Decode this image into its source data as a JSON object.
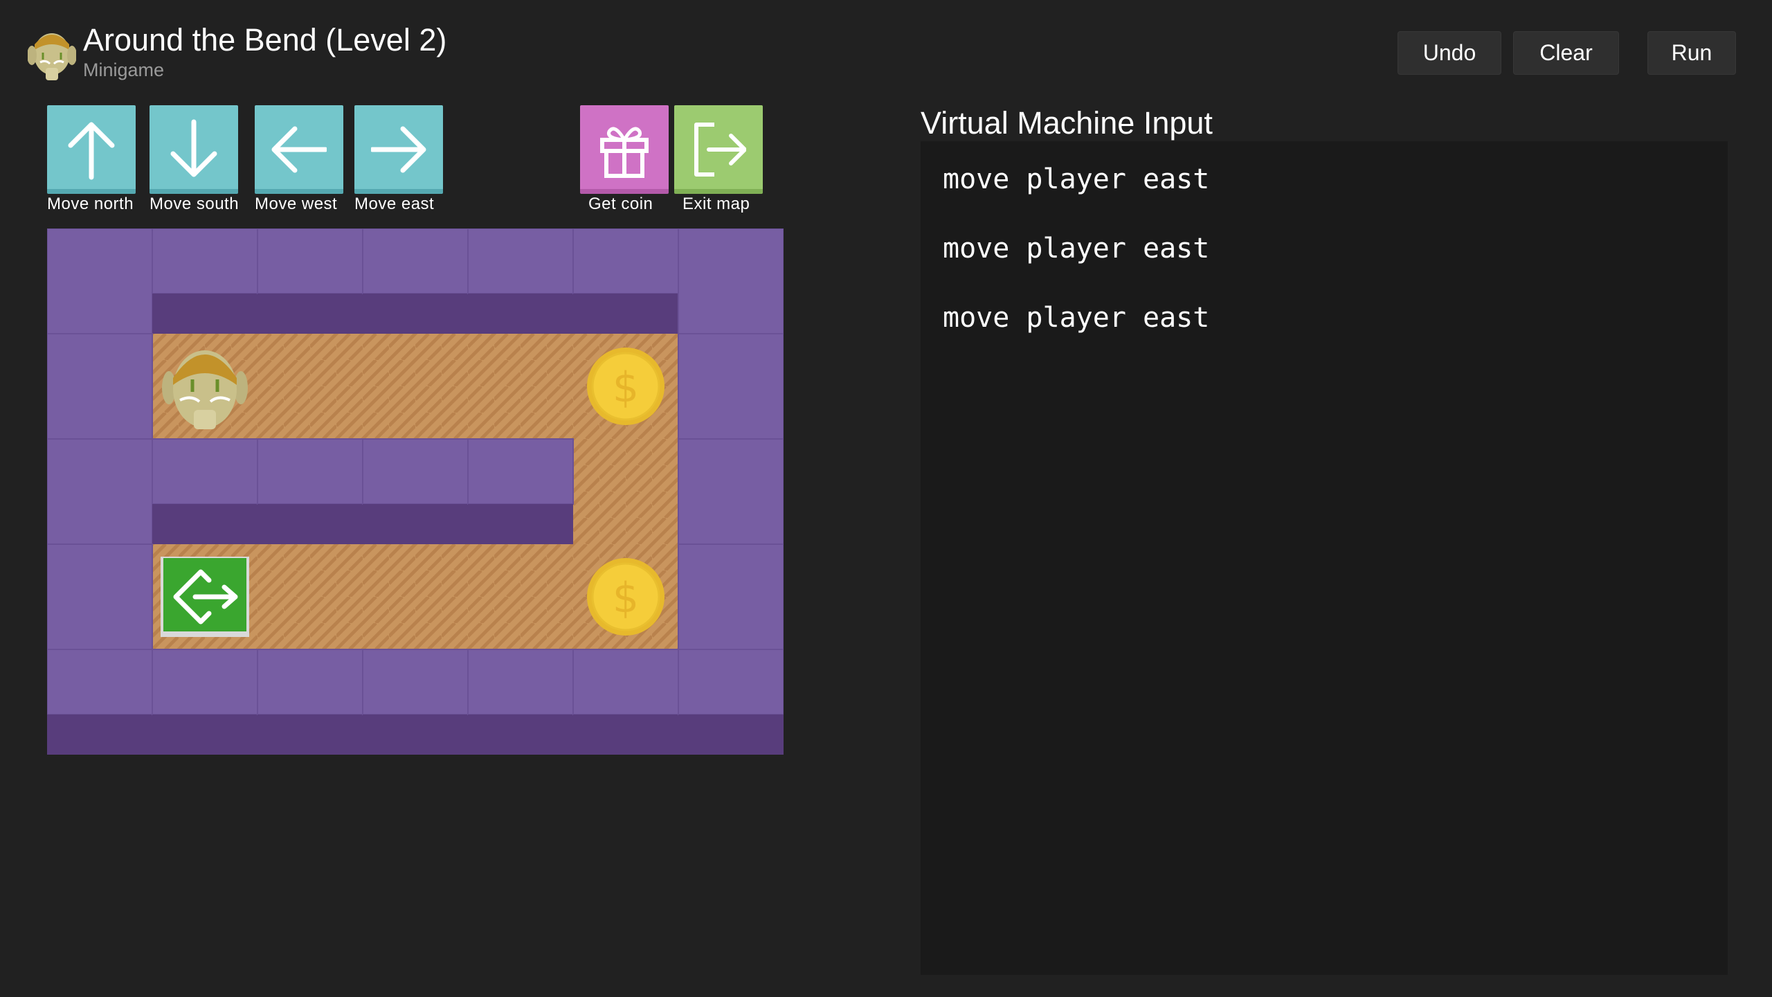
{
  "header": {
    "title": "Around the Bend (Level 2)",
    "subtitle": "Minigame",
    "icon": "goblin-avatar-icon",
    "buttons": {
      "undo": "Undo",
      "clear": "Clear",
      "run": "Run"
    }
  },
  "commands": [
    {
      "label": "Move north",
      "icon": "arrow-up-icon",
      "color": "#74c6cb"
    },
    {
      "label": "Move south",
      "icon": "arrow-down-icon",
      "color": "#74c6cb"
    },
    {
      "label": "Move west",
      "icon": "arrow-left-icon",
      "color": "#74c6cb"
    },
    {
      "label": "Move east",
      "icon": "arrow-right-icon",
      "color": "#74c6cb"
    },
    {
      "label": "Get coin",
      "icon": "gift-icon",
      "color": "#cf72c5"
    },
    {
      "label": "Exit map",
      "icon": "exit-icon",
      "color": "#9ccb70"
    }
  ],
  "board": {
    "cols": 7,
    "rows": 5,
    "grid": [
      "WWWWWWW",
      "WPFFFCW",
      "WWWWWFW",
      "WEFFFCW",
      "WWWWWWW"
    ],
    "legend": {
      "W": "wall",
      "F": "floor",
      "P": "player",
      "C": "coin",
      "E": "exit"
    },
    "colors": {
      "wall_top": "#775ea3",
      "wall_front": "#583d7c",
      "floor": "#c9955e",
      "coin": "#f5cd3a",
      "exit": "#3aa62f"
    },
    "coin_symbol": "$"
  },
  "vm": {
    "title": "Virtual Machine Input",
    "lines": [
      "move player east",
      "move player east",
      "move player east"
    ]
  }
}
